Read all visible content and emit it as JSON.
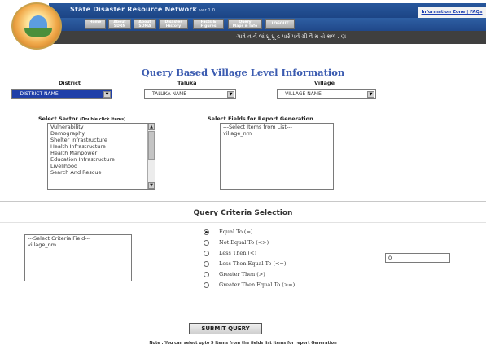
{
  "header": {
    "title": "State Disaster Resource Network",
    "version": "ver 1.0",
    "info_link": "Information Zone | FAQs",
    "lang_text": "ઞાત્રે તાર્ન લાં ધ્રૂ ધ્રૂ દ્ર પાર્ર પર્ન ગ્રી વૈ મ યે થળ . ણ"
  },
  "nav": [
    {
      "line1": "Home",
      "line2": ""
    },
    {
      "line1": "About",
      "line2": "SDRN"
    },
    {
      "line1": "About",
      "line2": "SDMA"
    },
    {
      "line1": "Disaster",
      "line2": "History"
    },
    {
      "line1": "Facts &",
      "line2": "Figures"
    },
    {
      "line1": "Query",
      "line2": "Maps & Info"
    },
    {
      "line1": "LOGOUT",
      "line2": ""
    }
  ],
  "page_title": "Query Based Village Level Information",
  "filters": {
    "district_label": "District",
    "taluka_label": "Taluka",
    "village_label": "Village",
    "district_value": "---DISTRICT NAME---",
    "taluka_value": "---TALUKA NAME---",
    "village_value": "---VILLAGE NAME---"
  },
  "sector": {
    "label": "Select Sector",
    "hint": "(Double click Items)",
    "items": [
      "Vulnerability",
      "Demography",
      "Shelter Infrastructure",
      "Health Infrastructure",
      "Health Manpower",
      "Education Infrastructure",
      "Livelihood",
      "Search And Rescue"
    ]
  },
  "fields": {
    "label": "Select Fields for Report Generation",
    "items": [
      "---Select Items from List---",
      "village_nm"
    ]
  },
  "criteria": {
    "title": "Query Criteria Selection",
    "field_items": [
      "---Select Criteria Field---",
      "village_nm"
    ],
    "options": [
      "Equal To (=)",
      "Not Equal To (<>)",
      "Less Then (<)",
      "Less Then Equal To (<=)",
      "Greater Then (>)",
      "Greater Then Equal To (>=)"
    ],
    "selected_index": 0,
    "value": "0"
  },
  "submit_label": "SUBMIT QUERY",
  "note": "Note : You can select upto 5 Items from the fields list items for report Generation"
}
